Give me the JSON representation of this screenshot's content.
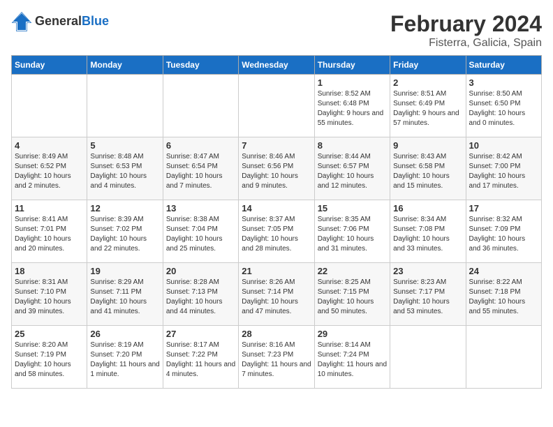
{
  "header": {
    "logo_general": "General",
    "logo_blue": "Blue",
    "title": "February 2024",
    "subtitle": "Fisterra, Galicia, Spain"
  },
  "weekdays": [
    "Sunday",
    "Monday",
    "Tuesday",
    "Wednesday",
    "Thursday",
    "Friday",
    "Saturday"
  ],
  "weeks": [
    [
      {
        "day": "",
        "sunrise": "",
        "sunset": "",
        "daylight": "",
        "empty": true
      },
      {
        "day": "",
        "sunrise": "",
        "sunset": "",
        "daylight": "",
        "empty": true
      },
      {
        "day": "",
        "sunrise": "",
        "sunset": "",
        "daylight": "",
        "empty": true
      },
      {
        "day": "",
        "sunrise": "",
        "sunset": "",
        "daylight": "",
        "empty": true
      },
      {
        "day": "1",
        "sunrise": "Sunrise: 8:52 AM",
        "sunset": "Sunset: 6:48 PM",
        "daylight": "Daylight: 9 hours and 55 minutes.",
        "empty": false
      },
      {
        "day": "2",
        "sunrise": "Sunrise: 8:51 AM",
        "sunset": "Sunset: 6:49 PM",
        "daylight": "Daylight: 9 hours and 57 minutes.",
        "empty": false
      },
      {
        "day": "3",
        "sunrise": "Sunrise: 8:50 AM",
        "sunset": "Sunset: 6:50 PM",
        "daylight": "Daylight: 10 hours and 0 minutes.",
        "empty": false
      }
    ],
    [
      {
        "day": "4",
        "sunrise": "Sunrise: 8:49 AM",
        "sunset": "Sunset: 6:52 PM",
        "daylight": "Daylight: 10 hours and 2 minutes.",
        "empty": false
      },
      {
        "day": "5",
        "sunrise": "Sunrise: 8:48 AM",
        "sunset": "Sunset: 6:53 PM",
        "daylight": "Daylight: 10 hours and 4 minutes.",
        "empty": false
      },
      {
        "day": "6",
        "sunrise": "Sunrise: 8:47 AM",
        "sunset": "Sunset: 6:54 PM",
        "daylight": "Daylight: 10 hours and 7 minutes.",
        "empty": false
      },
      {
        "day": "7",
        "sunrise": "Sunrise: 8:46 AM",
        "sunset": "Sunset: 6:56 PM",
        "daylight": "Daylight: 10 hours and 9 minutes.",
        "empty": false
      },
      {
        "day": "8",
        "sunrise": "Sunrise: 8:44 AM",
        "sunset": "Sunset: 6:57 PM",
        "daylight": "Daylight: 10 hours and 12 minutes.",
        "empty": false
      },
      {
        "day": "9",
        "sunrise": "Sunrise: 8:43 AM",
        "sunset": "Sunset: 6:58 PM",
        "daylight": "Daylight: 10 hours and 15 minutes.",
        "empty": false
      },
      {
        "day": "10",
        "sunrise": "Sunrise: 8:42 AM",
        "sunset": "Sunset: 7:00 PM",
        "daylight": "Daylight: 10 hours and 17 minutes.",
        "empty": false
      }
    ],
    [
      {
        "day": "11",
        "sunrise": "Sunrise: 8:41 AM",
        "sunset": "Sunset: 7:01 PM",
        "daylight": "Daylight: 10 hours and 20 minutes.",
        "empty": false
      },
      {
        "day": "12",
        "sunrise": "Sunrise: 8:39 AM",
        "sunset": "Sunset: 7:02 PM",
        "daylight": "Daylight: 10 hours and 22 minutes.",
        "empty": false
      },
      {
        "day": "13",
        "sunrise": "Sunrise: 8:38 AM",
        "sunset": "Sunset: 7:04 PM",
        "daylight": "Daylight: 10 hours and 25 minutes.",
        "empty": false
      },
      {
        "day": "14",
        "sunrise": "Sunrise: 8:37 AM",
        "sunset": "Sunset: 7:05 PM",
        "daylight": "Daylight: 10 hours and 28 minutes.",
        "empty": false
      },
      {
        "day": "15",
        "sunrise": "Sunrise: 8:35 AM",
        "sunset": "Sunset: 7:06 PM",
        "daylight": "Daylight: 10 hours and 31 minutes.",
        "empty": false
      },
      {
        "day": "16",
        "sunrise": "Sunrise: 8:34 AM",
        "sunset": "Sunset: 7:08 PM",
        "daylight": "Daylight: 10 hours and 33 minutes.",
        "empty": false
      },
      {
        "day": "17",
        "sunrise": "Sunrise: 8:32 AM",
        "sunset": "Sunset: 7:09 PM",
        "daylight": "Daylight: 10 hours and 36 minutes.",
        "empty": false
      }
    ],
    [
      {
        "day": "18",
        "sunrise": "Sunrise: 8:31 AM",
        "sunset": "Sunset: 7:10 PM",
        "daylight": "Daylight: 10 hours and 39 minutes.",
        "empty": false
      },
      {
        "day": "19",
        "sunrise": "Sunrise: 8:29 AM",
        "sunset": "Sunset: 7:11 PM",
        "daylight": "Daylight: 10 hours and 41 minutes.",
        "empty": false
      },
      {
        "day": "20",
        "sunrise": "Sunrise: 8:28 AM",
        "sunset": "Sunset: 7:13 PM",
        "daylight": "Daylight: 10 hours and 44 minutes.",
        "empty": false
      },
      {
        "day": "21",
        "sunrise": "Sunrise: 8:26 AM",
        "sunset": "Sunset: 7:14 PM",
        "daylight": "Daylight: 10 hours and 47 minutes.",
        "empty": false
      },
      {
        "day": "22",
        "sunrise": "Sunrise: 8:25 AM",
        "sunset": "Sunset: 7:15 PM",
        "daylight": "Daylight: 10 hours and 50 minutes.",
        "empty": false
      },
      {
        "day": "23",
        "sunrise": "Sunrise: 8:23 AM",
        "sunset": "Sunset: 7:17 PM",
        "daylight": "Daylight: 10 hours and 53 minutes.",
        "empty": false
      },
      {
        "day": "24",
        "sunrise": "Sunrise: 8:22 AM",
        "sunset": "Sunset: 7:18 PM",
        "daylight": "Daylight: 10 hours and 55 minutes.",
        "empty": false
      }
    ],
    [
      {
        "day": "25",
        "sunrise": "Sunrise: 8:20 AM",
        "sunset": "Sunset: 7:19 PM",
        "daylight": "Daylight: 10 hours and 58 minutes.",
        "empty": false
      },
      {
        "day": "26",
        "sunrise": "Sunrise: 8:19 AM",
        "sunset": "Sunset: 7:20 PM",
        "daylight": "Daylight: 11 hours and 1 minute.",
        "empty": false
      },
      {
        "day": "27",
        "sunrise": "Sunrise: 8:17 AM",
        "sunset": "Sunset: 7:22 PM",
        "daylight": "Daylight: 11 hours and 4 minutes.",
        "empty": false
      },
      {
        "day": "28",
        "sunrise": "Sunrise: 8:16 AM",
        "sunset": "Sunset: 7:23 PM",
        "daylight": "Daylight: 11 hours and 7 minutes.",
        "empty": false
      },
      {
        "day": "29",
        "sunrise": "Sunrise: 8:14 AM",
        "sunset": "Sunset: 7:24 PM",
        "daylight": "Daylight: 11 hours and 10 minutes.",
        "empty": false
      },
      {
        "day": "",
        "sunrise": "",
        "sunset": "",
        "daylight": "",
        "empty": true
      },
      {
        "day": "",
        "sunrise": "",
        "sunset": "",
        "daylight": "",
        "empty": true
      }
    ]
  ]
}
